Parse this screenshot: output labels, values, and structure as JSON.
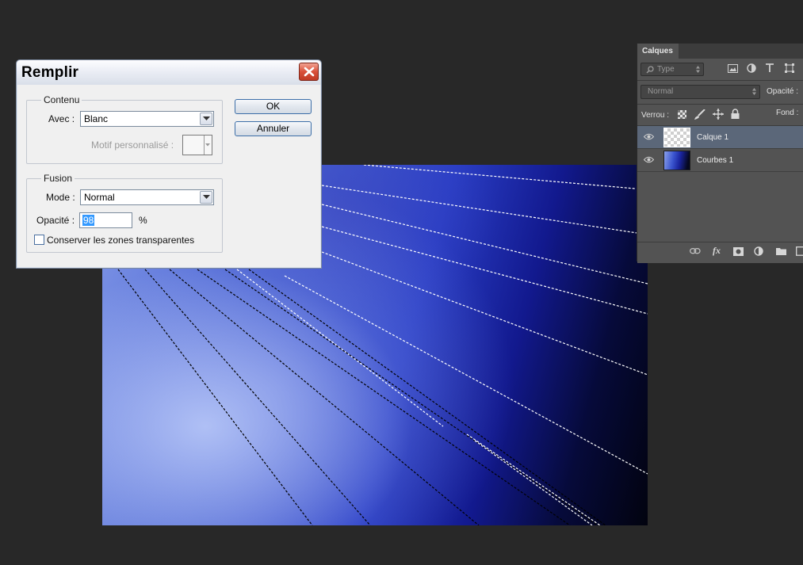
{
  "dialog": {
    "title": "Remplir",
    "ok_label": "OK",
    "cancel_label": "Annuler",
    "content_group": {
      "legend": "Contenu",
      "use_label": "Avec :",
      "use_value": "Blanc",
      "pattern_label": "Motif personnalisé :"
    },
    "blend_group": {
      "legend": "Fusion",
      "mode_label": "Mode :",
      "mode_value": "Normal",
      "opacity_label": "Opacité :",
      "opacity_value": "98",
      "percent_sign": "%",
      "preserve_label": "Conserver les zones transparentes",
      "preserve_checked": false
    }
  },
  "layers_panel": {
    "tab_label": "Calques",
    "filter_type": "Type",
    "blend_mode": "Normal",
    "opacity_label": "Opacité :",
    "lock_label": "Verrou :",
    "fill_label": "Fond :",
    "layers": [
      {
        "name": "Calque 1",
        "selected": true,
        "visible": true,
        "thumb": "transparent-checker"
      },
      {
        "name": "Courbes 1",
        "selected": false,
        "visible": true,
        "thumb": "blue-texture"
      }
    ],
    "footer_icons": [
      "link-icon",
      "fx-icon",
      "mask-icon",
      "adjustment-icon",
      "folder-icon",
      "new-layer-icon"
    ]
  },
  "canvas": {
    "content": "blue texture with dashed selection rays"
  },
  "colors": {
    "app_background": "#282828",
    "panel_background": "#535353",
    "selected_layer": "#5b6779",
    "close_button": "#d9503a"
  }
}
